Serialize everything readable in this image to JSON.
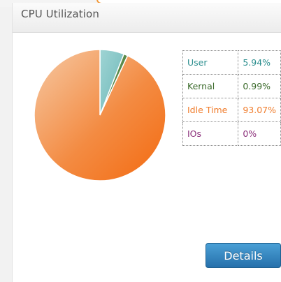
{
  "panel": {
    "title": "CPU Utilization",
    "details_label": "Details"
  },
  "chart_data": {
    "type": "pie",
    "labels": [
      "User",
      "Kernal",
      "Idle Time",
      "IOs"
    ],
    "values": [
      5.94,
      0.99,
      93.07,
      0
    ],
    "colors": [
      "#7ec3c3",
      "#5a8a4a",
      "#f27f2a",
      "#8b2f7a"
    ]
  },
  "stats": [
    {
      "label": "User",
      "value": "5.94%",
      "color": "#2d8f8f"
    },
    {
      "label": "Kernal",
      "value": "0.99%",
      "color": "#3c6b2c"
    },
    {
      "label": "Idle Time",
      "value": "93.07%",
      "color": "#f07d2d"
    },
    {
      "label": "IOs",
      "value": "0%",
      "color": "#8b2f7a"
    }
  ]
}
